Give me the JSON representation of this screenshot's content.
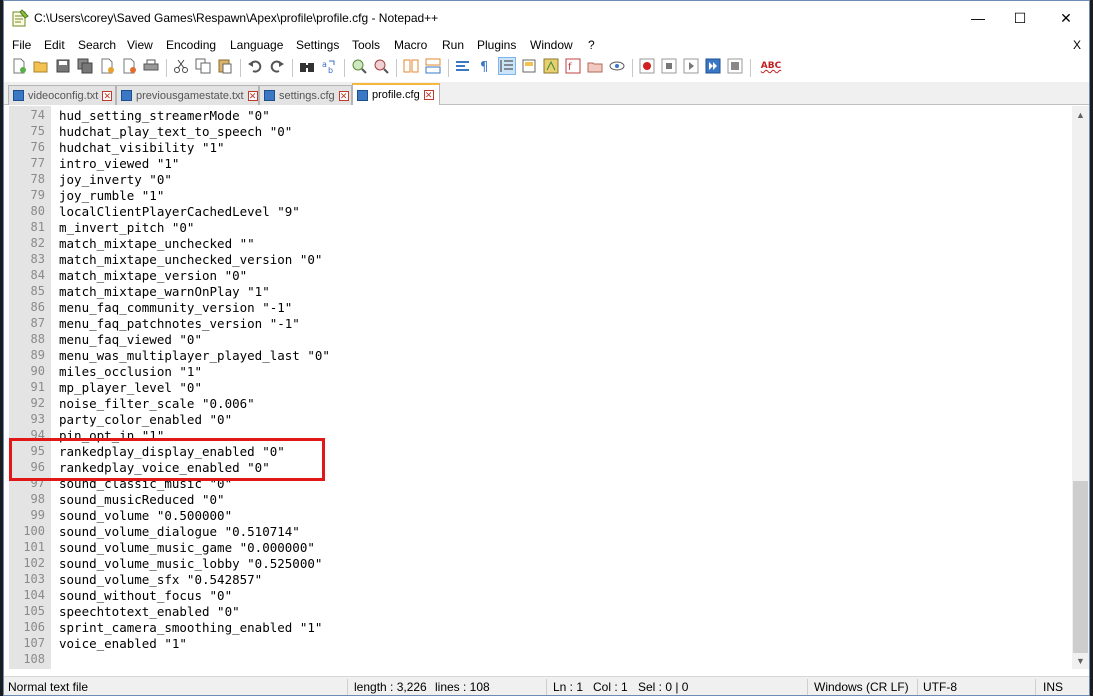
{
  "window": {
    "title": "C:\\Users\\corey\\Saved Games\\Respawn\\Apex\\profile\\profile.cfg - Notepad++",
    "minimize_glyph": "—",
    "maximize_glyph": "☐",
    "close_glyph": "✕"
  },
  "menu": {
    "items": [
      "File",
      "Edit",
      "Search",
      "View",
      "Encoding",
      "Language",
      "Settings",
      "Tools",
      "Macro",
      "Run",
      "Plugins",
      "Window",
      "?"
    ],
    "close_x": "X"
  },
  "toolbar": {
    "icons": [
      "new-file-icon",
      "open-file-icon",
      "save-icon",
      "save-all-icon",
      "close-icon",
      "close-all-icon",
      "print-icon",
      "cut-icon",
      "copy-icon",
      "paste-icon",
      "undo-icon",
      "redo-icon",
      "find-icon",
      "replace-icon",
      "zoom-in-icon",
      "zoom-out-icon",
      "sync-vertical-icon",
      "sync-horizontal-icon",
      "word-wrap-icon",
      "show-all-chars-icon",
      "indent-guide-icon",
      "doc-map-icon",
      "function-list-icon",
      "folder-as-workspace-icon",
      "document-list-icon",
      "monitoring-icon",
      "record-macro-icon",
      "stop-macro-icon",
      "play-macro-icon",
      "run-macro-multiple-icon",
      "save-macro-icon",
      "spell-check-icon"
    ],
    "spell_check_label": "ABC"
  },
  "tabs": [
    {
      "label": "videoconfig.txt",
      "active": false
    },
    {
      "label": "previousgamestate.txt",
      "active": false
    },
    {
      "label": "settings.cfg",
      "active": false
    },
    {
      "label": "profile.cfg",
      "active": true
    }
  ],
  "editor": {
    "lines": [
      {
        "n": "74",
        "text": "hud_setting_streamerMode \"0\""
      },
      {
        "n": "75",
        "text": "hudchat_play_text_to_speech \"0\""
      },
      {
        "n": "76",
        "text": "hudchat_visibility \"1\""
      },
      {
        "n": "77",
        "text": "intro_viewed \"1\""
      },
      {
        "n": "78",
        "text": "joy_inverty \"0\""
      },
      {
        "n": "79",
        "text": "joy_rumble \"1\""
      },
      {
        "n": "80",
        "text": "localClientPlayerCachedLevel \"9\""
      },
      {
        "n": "81",
        "text": "m_invert_pitch \"0\""
      },
      {
        "n": "82",
        "text": "match_mixtape_unchecked \"\""
      },
      {
        "n": "83",
        "text": "match_mixtape_unchecked_version \"0\""
      },
      {
        "n": "84",
        "text": "match_mixtape_version \"0\""
      },
      {
        "n": "85",
        "text": "match_mixtape_warnOnPlay \"1\""
      },
      {
        "n": "86",
        "text": "menu_faq_community_version \"-1\""
      },
      {
        "n": "87",
        "text": "menu_faq_patchnotes_version \"-1\""
      },
      {
        "n": "88",
        "text": "menu_faq_viewed \"0\""
      },
      {
        "n": "89",
        "text": "menu_was_multiplayer_played_last \"0\""
      },
      {
        "n": "90",
        "text": "miles_occlusion \"1\""
      },
      {
        "n": "91",
        "text": "mp_player_level \"0\""
      },
      {
        "n": "92",
        "text": "noise_filter_scale \"0.006\""
      },
      {
        "n": "93",
        "text": "party_color_enabled \"0\""
      },
      {
        "n": "94",
        "text": "pin_opt_in \"1\""
      },
      {
        "n": "95",
        "text": "rankedplay_display_enabled \"0\""
      },
      {
        "n": "96",
        "text": "rankedplay_voice_enabled \"0\""
      },
      {
        "n": "97",
        "text": "sound_classic_music \"0\""
      },
      {
        "n": "98",
        "text": "sound_musicReduced \"0\""
      },
      {
        "n": "99",
        "text": "sound_volume \"0.500000\""
      },
      {
        "n": "100",
        "text": "sound_volume_dialogue \"0.510714\""
      },
      {
        "n": "101",
        "text": "sound_volume_music_game \"0.000000\""
      },
      {
        "n": "102",
        "text": "sound_volume_music_lobby \"0.525000\""
      },
      {
        "n": "103",
        "text": "sound_volume_sfx \"0.542857\""
      },
      {
        "n": "104",
        "text": "sound_without_focus \"0\""
      },
      {
        "n": "105",
        "text": "speechtotext_enabled \"0\""
      },
      {
        "n": "106",
        "text": "sprint_camera_smoothing_enabled \"1\""
      },
      {
        "n": "107",
        "text": "voice_enabled \"1\""
      },
      {
        "n": "108",
        "text": ""
      }
    ],
    "highlight_color": "#e01818"
  },
  "status": {
    "file_type": "Normal text file",
    "length": "length : 3,226",
    "lines": "lines : 108",
    "ln": "Ln : 1",
    "col": "Col : 1",
    "sel": "Sel : 0 | 0",
    "eol": "Windows (CR LF)",
    "encoding": "UTF-8",
    "mode": "INS"
  }
}
